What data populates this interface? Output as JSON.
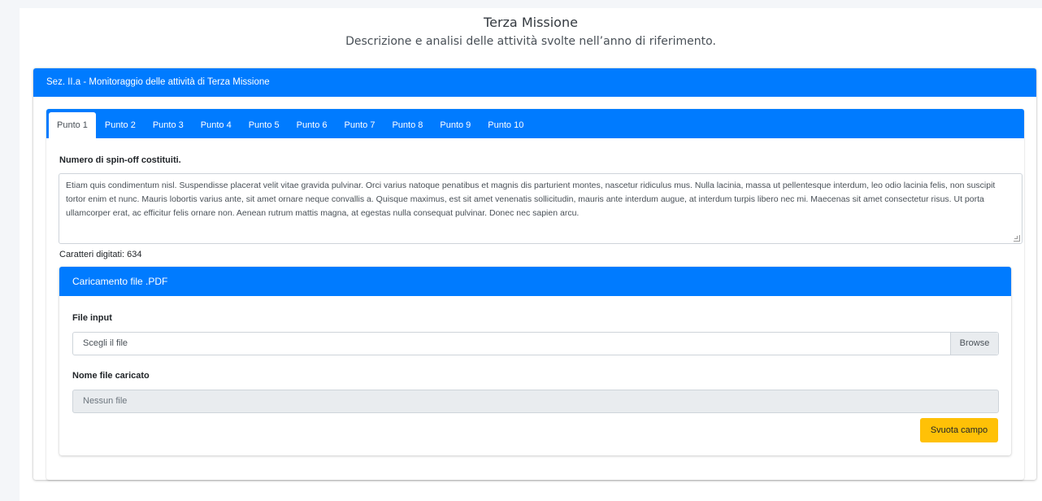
{
  "header": {
    "title": "Terza Missione",
    "subtitle": "Descrizione e analisi delle attività svolte nell’anno di riferimento."
  },
  "section": {
    "title": "Sez. II.a - Monitoraggio delle attività di Terza Missione"
  },
  "tabs": [
    {
      "label": "Punto 1",
      "active": true
    },
    {
      "label": "Punto 2",
      "active": false
    },
    {
      "label": "Punto 3",
      "active": false
    },
    {
      "label": "Punto 4",
      "active": false
    },
    {
      "label": "Punto 5",
      "active": false
    },
    {
      "label": "Punto 6",
      "active": false
    },
    {
      "label": "Punto 7",
      "active": false
    },
    {
      "label": "Punto 8",
      "active": false
    },
    {
      "label": "Punto 9",
      "active": false
    },
    {
      "label": "Punto 10",
      "active": false
    }
  ],
  "question": {
    "label": "Numero di spin-off costituiti.",
    "text": "Etiam quis condimentum nisl. Suspendisse placerat velit vitae gravida pulvinar. Orci varius natoque penatibus et magnis dis parturient montes, nascetur ridiculus mus. Nulla lacinia, massa ut pellentesque interdum, leo odio lacinia felis, non suscipit tortor enim et nunc. Mauris lobortis varius ante, sit amet ornare neque convallis a. Quisque maximus, est sit amet venenatis sollicitudin, mauris ante interdum augue, at interdum turpis libero nec mi. Maecenas sit amet consectetur risus. Ut porta ullamcorper erat, ac efficitur felis ornare non. Aenean rutrum mattis magna, at egestas nulla consequat pulvinar. Donec nec sapien arcu.",
    "char_count": "Caratteri digitati: 634"
  },
  "upload": {
    "title": "Caricamento file .PDF",
    "file_input_label": "File input",
    "file_placeholder": "Scegli il file",
    "browse_label": "Browse",
    "uploaded_label": "Nome file caricato",
    "uploaded_value": "Nessun file",
    "clear_button": "Svuota campo"
  },
  "colors": {
    "primary": "#007bff",
    "warning": "#ffc107",
    "readonly_bg": "#e9ecef"
  }
}
